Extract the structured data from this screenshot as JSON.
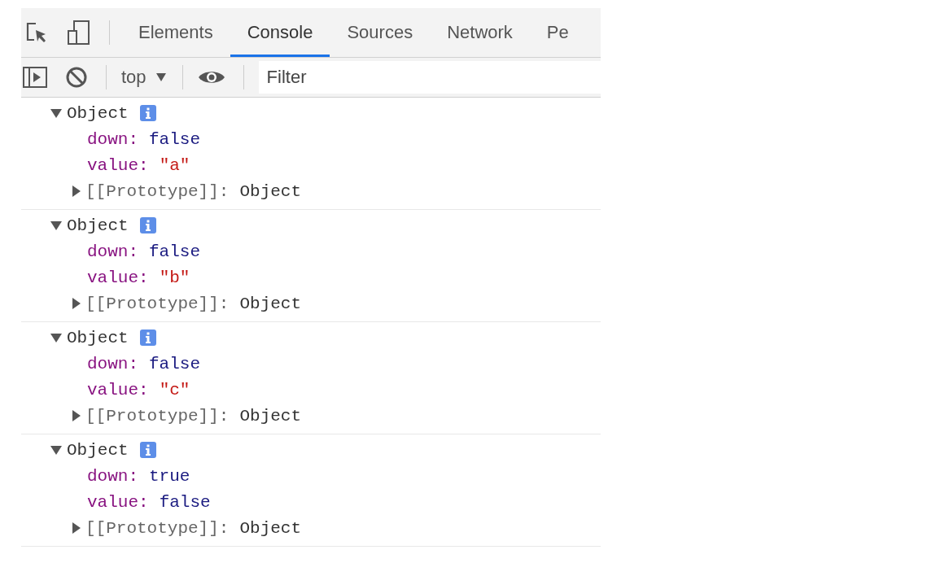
{
  "tabs": [
    {
      "label": "Elements",
      "selected": false
    },
    {
      "label": "Console",
      "selected": true
    },
    {
      "label": "Sources",
      "selected": false
    },
    {
      "label": "Network",
      "selected": false
    },
    {
      "label": "Pe",
      "selected": false
    }
  ],
  "toolbar": {
    "context": "top",
    "filter_placeholder": "Filter"
  },
  "entries": [
    {
      "label": "Object",
      "expanded": true,
      "properties": [
        {
          "key": "down:",
          "value": "false",
          "kind": "boolean"
        },
        {
          "key": "value:",
          "value": "\"a\"",
          "kind": "string"
        }
      ],
      "prototype": {
        "key": "[[Prototype]]:",
        "value": "Object",
        "expanded": false
      }
    },
    {
      "label": "Object",
      "expanded": true,
      "properties": [
        {
          "key": "down:",
          "value": "false",
          "kind": "boolean"
        },
        {
          "key": "value:",
          "value": "\"b\"",
          "kind": "string"
        }
      ],
      "prototype": {
        "key": "[[Prototype]]:",
        "value": "Object",
        "expanded": false
      }
    },
    {
      "label": "Object",
      "expanded": true,
      "properties": [
        {
          "key": "down:",
          "value": "false",
          "kind": "boolean"
        },
        {
          "key": "value:",
          "value": "\"c\"",
          "kind": "string"
        }
      ],
      "prototype": {
        "key": "[[Prototype]]:",
        "value": "Object",
        "expanded": false
      }
    },
    {
      "label": "Object",
      "expanded": true,
      "properties": [
        {
          "key": "down:",
          "value": "true",
          "kind": "boolean"
        },
        {
          "key": "value:",
          "value": "false",
          "kind": "boolean"
        }
      ],
      "prototype": {
        "key": "[[Prototype]]:",
        "value": "Object",
        "expanded": false
      }
    }
  ]
}
